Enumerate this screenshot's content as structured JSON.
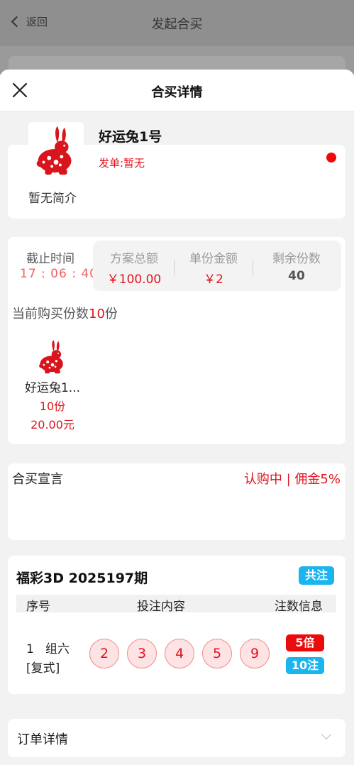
{
  "background": {
    "back_label": "返回",
    "page_title": "发起合买"
  },
  "sheet": {
    "title": "合买详情",
    "close_icon": "close-icon"
  },
  "plan": {
    "name": "好运兔1号",
    "issuer": "发单:暂无",
    "intro": "暂无简介",
    "avatar_icon": "rabbit-papercut-icon"
  },
  "stats": {
    "deadline_label": "截止时间",
    "deadline_value": "17 : 06 : 40",
    "total_label": "方案总额",
    "total_value": "￥100.00",
    "unit_label": "单份金额",
    "unit_value": "￥2",
    "remaining_label": "剩余份数",
    "remaining_value": "40"
  },
  "current": {
    "prefix": "当前购买份数",
    "count": "10",
    "suffix": "份"
  },
  "members": [
    {
      "name": "好运兔1...",
      "shares": "10份",
      "amount": "20.00元"
    }
  ],
  "declaration": {
    "label": "合买宣言",
    "status": "认购中 | 佣金5%"
  },
  "bet": {
    "lottery": "福彩3D 2025197期",
    "total_badge": "共注",
    "headers": [
      "序号",
      "投注内容",
      "注数信息"
    ],
    "row": {
      "index_type": "1   组六",
      "play": "[复式]",
      "balls": [
        "2",
        "3",
        "4",
        "5",
        "9"
      ],
      "multiplier": "5倍",
      "count": "10注"
    }
  },
  "order": {
    "label": "订单详情"
  },
  "colors": {
    "accent_red": "#e0141e",
    "accent_blue": "#1ab4ee",
    "ball_fill": "#fde3e3"
  }
}
